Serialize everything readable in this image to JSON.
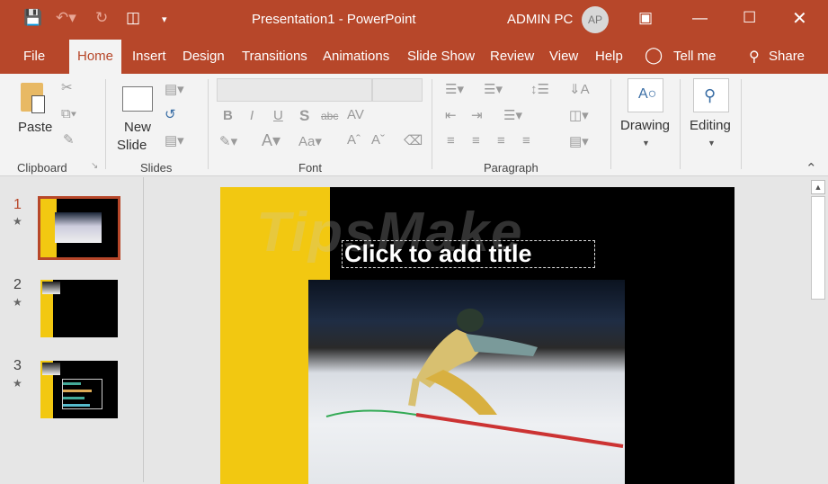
{
  "titlebar": {
    "title": "Presentation1  -  PowerPoint",
    "user": "ADMIN PC",
    "avatar": "AP"
  },
  "tabs": [
    "File",
    "Home",
    "Insert",
    "Design",
    "Transitions",
    "Animations",
    "Slide Show",
    "Review",
    "View",
    "Help"
  ],
  "tell_me": "Tell me",
  "share": "Share",
  "ribbon": {
    "paste": "Paste",
    "new_slide_1": "New",
    "new_slide_2": "Slide",
    "drawing": "Drawing",
    "editing": "Editing",
    "groups": {
      "clipboard": "Clipboard",
      "slides": "Slides",
      "font": "Font",
      "paragraph": "Paragraph"
    }
  },
  "thumbnails": [
    {
      "num": "1"
    },
    {
      "num": "2"
    },
    {
      "num": "3"
    }
  ],
  "slide": {
    "title_placeholder": "Click to add title",
    "watermark": "TipsMake"
  },
  "colors": {
    "accent": "#b7472a",
    "yellow": "#f2c811"
  }
}
